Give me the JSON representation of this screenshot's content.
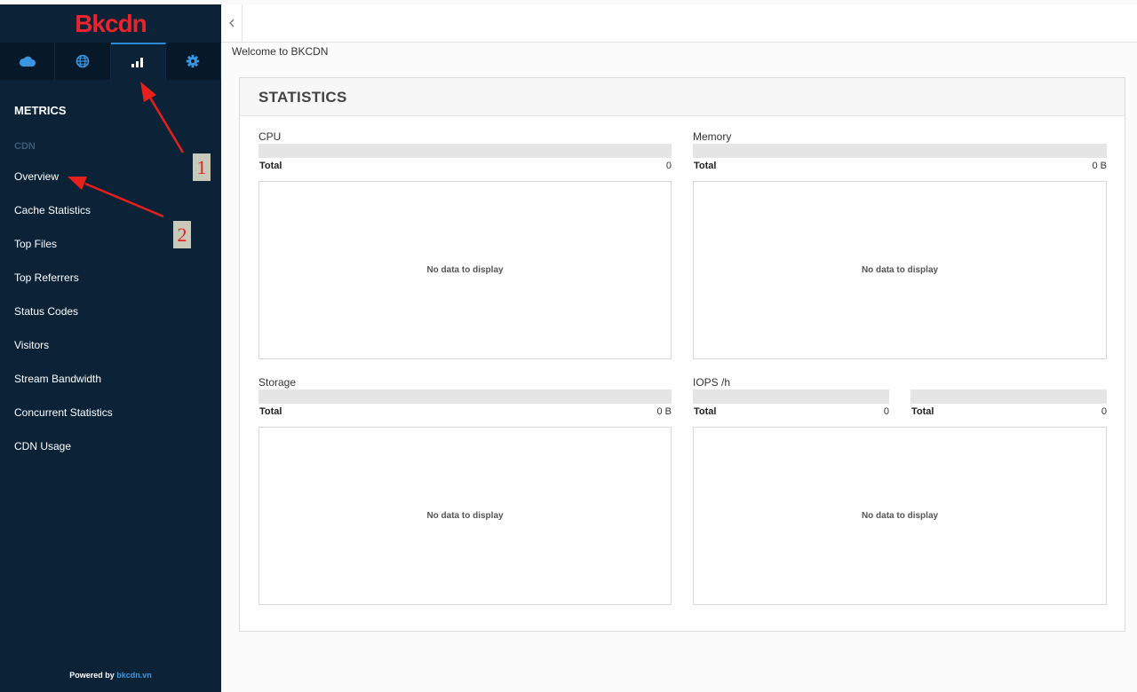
{
  "logo": {
    "text": "Bkcdn"
  },
  "nav_tabs": [
    {
      "icon": "cloud-icon"
    },
    {
      "icon": "globe-icon"
    },
    {
      "icon": "bar-chart-icon",
      "active": true
    },
    {
      "icon": "gear-icon"
    }
  ],
  "sidebar": {
    "section_title": "METRICS",
    "group_label": "CDN",
    "items": [
      {
        "label": "Overview"
      },
      {
        "label": "Cache Statistics"
      },
      {
        "label": "Top Files"
      },
      {
        "label": "Top Referrers"
      },
      {
        "label": "Status Codes"
      },
      {
        "label": "Visitors"
      },
      {
        "label": "Stream Bandwidth"
      },
      {
        "label": "Concurrent Statistics"
      },
      {
        "label": "CDN Usage"
      }
    ],
    "powered_by": "Powered by",
    "powered_link": "bkcdn.vn"
  },
  "header": {
    "collapse_icon": "chevron-left-icon"
  },
  "main": {
    "welcome": "Welcome to BKCDN",
    "panel_title": "STATISTICS",
    "metrics": {
      "cpu": {
        "label": "CPU",
        "total_label": "Total",
        "total_value": "0",
        "empty_text": "No data to display"
      },
      "memory": {
        "label": "Memory",
        "total_label": "Total",
        "total_value": "0 B",
        "empty_text": "No data to display"
      },
      "storage": {
        "label": "Storage",
        "total_label": "Total",
        "total_value": "0 B",
        "empty_text": "No data to display"
      },
      "iops": {
        "label": "IOPS /h",
        "totals": [
          {
            "total_label": "Total",
            "total_value": "0"
          },
          {
            "total_label": "Total",
            "total_value": "0"
          }
        ],
        "empty_text": "No data to display"
      }
    }
  },
  "annotations": [
    {
      "number": "1"
    },
    {
      "number": "2"
    }
  ],
  "colors": {
    "sidebar_bg": "#0b2237",
    "accent": "#2a8ad6",
    "logo": "#e8242e",
    "annotation": "#e8201c"
  }
}
